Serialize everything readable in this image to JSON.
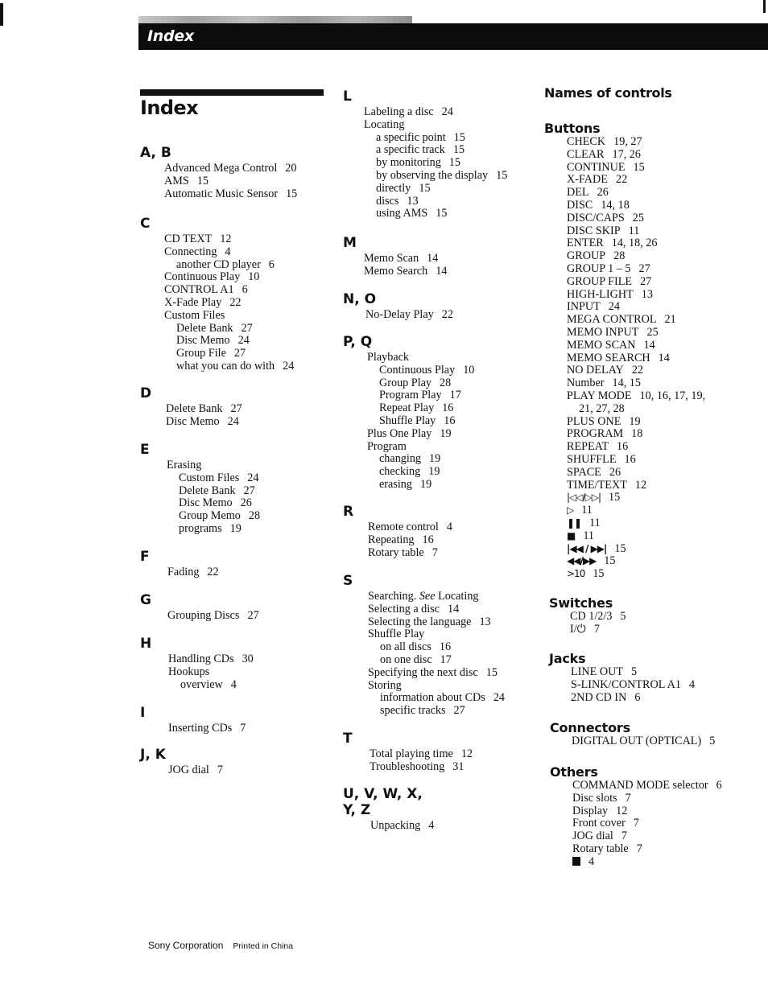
{
  "header": {
    "title": "Index"
  },
  "page_title": "Index",
  "left_sections": [
    {
      "letter": "A, B",
      "entries": [
        {
          "text": "Advanced Mega Control",
          "page": "20"
        },
        {
          "text": "AMS",
          "page": "15"
        },
        {
          "text": "Automatic Music Sensor",
          "page": "15"
        }
      ]
    },
    {
      "letter": "C",
      "entries": [
        {
          "text": "CD TEXT",
          "page": "12"
        },
        {
          "text": "Connecting",
          "page": "4"
        },
        {
          "text": "another CD player",
          "page": "6",
          "sub": true
        },
        {
          "text": "Continuous Play",
          "page": "10"
        },
        {
          "text": "CONTROL A1",
          "page": "6"
        },
        {
          "text": "X-Fade Play",
          "page": "22"
        },
        {
          "text": "Custom Files",
          "page": ""
        },
        {
          "text": "Delete Bank",
          "page": "27",
          "sub": true
        },
        {
          "text": "Disc Memo",
          "page": "24",
          "sub": true
        },
        {
          "text": "Group File",
          "page": "27",
          "sub": true
        },
        {
          "text": "what you can do with",
          "page": "24",
          "sub": true
        }
      ]
    },
    {
      "letter": "D",
      "entries": [
        {
          "text": "Delete Bank",
          "page": "27"
        },
        {
          "text": "Disc Memo",
          "page": "24"
        }
      ]
    },
    {
      "letter": "E",
      "entries": [
        {
          "text": "Erasing",
          "page": ""
        },
        {
          "text": "Custom Files",
          "page": "24",
          "sub": true
        },
        {
          "text": "Delete Bank",
          "page": "27",
          "sub": true
        },
        {
          "text": "Disc Memo",
          "page": "26",
          "sub": true
        },
        {
          "text": "Group Memo",
          "page": "28",
          "sub": true
        },
        {
          "text": "programs",
          "page": "19",
          "sub": true
        }
      ]
    },
    {
      "letter": "F",
      "entries": [
        {
          "text": "Fading",
          "page": "22"
        }
      ]
    },
    {
      "letter": "G",
      "entries": [
        {
          "text": "Grouping Discs",
          "page": "27"
        }
      ]
    },
    {
      "letter": "H",
      "entries": [
        {
          "text": "Handling CDs",
          "page": "30"
        },
        {
          "text": "Hookups",
          "page": ""
        },
        {
          "text": "overview",
          "page": "4",
          "sub": true
        }
      ]
    },
    {
      "letter": "I",
      "entries": [
        {
          "text": "Inserting CDs",
          "page": "7"
        }
      ]
    },
    {
      "letter": "J, K",
      "entries": [
        {
          "text": "JOG dial",
          "page": "7"
        }
      ]
    }
  ],
  "middle_sections": [
    {
      "letter": "L",
      "entries": [
        {
          "text": "Labeling a disc",
          "page": "24"
        },
        {
          "text": "Locating",
          "page": ""
        },
        {
          "text": "a specific point",
          "page": "15",
          "sub": true
        },
        {
          "text": "a specific track",
          "page": "15",
          "sub": true
        },
        {
          "text": "by monitoring",
          "page": "15",
          "sub": true
        },
        {
          "text": "by observing the display",
          "page": "15",
          "sub": true
        },
        {
          "text": "directly",
          "page": "15",
          "sub": true
        },
        {
          "text": "discs",
          "page": "13",
          "sub": true
        },
        {
          "text": "using AMS",
          "page": "15",
          "sub": true
        }
      ]
    },
    {
      "letter": "M",
      "entries": [
        {
          "text": "Memo Scan",
          "page": "14"
        },
        {
          "text": "Memo Search",
          "page": "14"
        }
      ]
    },
    {
      "letter": "N, O",
      "entries": [
        {
          "text": "No-Delay Play",
          "page": "22"
        }
      ]
    },
    {
      "letter": "P, Q",
      "entries": [
        {
          "text": "Playback",
          "page": ""
        },
        {
          "text": "Continuous Play",
          "page": "10",
          "sub": true
        },
        {
          "text": "Group Play",
          "page": "28",
          "sub": true
        },
        {
          "text": "Program Play",
          "page": "17",
          "sub": true
        },
        {
          "text": "Repeat Play",
          "page": "16",
          "sub": true
        },
        {
          "text": "Shuffle Play",
          "page": "16",
          "sub": true
        },
        {
          "text": "Plus One Play",
          "page": "19"
        },
        {
          "text": "Program",
          "page": ""
        },
        {
          "text": "changing",
          "page": "19",
          "sub": true
        },
        {
          "text": "checking",
          "page": "19",
          "sub": true
        },
        {
          "text": "erasing",
          "page": "19",
          "sub": true
        }
      ]
    },
    {
      "letter": "R",
      "entries": [
        {
          "text": "Remote control",
          "page": "4"
        },
        {
          "text": "Repeating",
          "page": "16"
        },
        {
          "text": "Rotary table",
          "page": "7"
        }
      ]
    },
    {
      "letter": "S",
      "entries": [
        {
          "text": "Searching.",
          "see": "See",
          "see_target": "Locating",
          "page": ""
        },
        {
          "text": "Selecting a disc",
          "page": "14"
        },
        {
          "text": "Selecting the language",
          "page": "13"
        },
        {
          "text": "Shuffle Play",
          "page": ""
        },
        {
          "text": "on all discs",
          "page": "16",
          "sub": true
        },
        {
          "text": "on one disc",
          "page": "17",
          "sub": true
        },
        {
          "text": "Specifying the next disc",
          "page": "15"
        },
        {
          "text": "Storing",
          "page": ""
        },
        {
          "text": "information about CDs",
          "page": "24",
          "sub": true
        },
        {
          "text": "specific tracks",
          "page": "27",
          "sub": true
        }
      ]
    },
    {
      "letter": "T",
      "entries": [
        {
          "text": "Total playing time",
          "page": "12"
        },
        {
          "text": "Troubleshooting",
          "page": "31"
        }
      ]
    },
    {
      "letter": "U, V, W, X, Y, Z",
      "entries": [
        {
          "text": "Unpacking",
          "page": "4"
        }
      ]
    }
  ],
  "names_of_controls": {
    "heading": "Names of controls",
    "buttons": {
      "heading": "Buttons",
      "entries": [
        {
          "text": "CHECK",
          "page": "19, 27"
        },
        {
          "text": "CLEAR",
          "page": "17, 26"
        },
        {
          "text": "CONTINUE",
          "page": "15"
        },
        {
          "text": "X-FADE",
          "page": "22"
        },
        {
          "text": "DEL",
          "page": "26"
        },
        {
          "text": "DISC",
          "page": "14, 18"
        },
        {
          "text": "DISC/CAPS",
          "page": "25"
        },
        {
          "text": "DISC SKIP",
          "page": "11"
        },
        {
          "text": "ENTER",
          "page": "14, 18, 26"
        },
        {
          "text": "GROUP",
          "page": "28"
        },
        {
          "text": "GROUP 1 – 5",
          "page": "27"
        },
        {
          "text": "GROUP FILE",
          "page": "27"
        },
        {
          "text": "HIGH-LIGHT",
          "page": "13"
        },
        {
          "text": "INPUT",
          "page": "24"
        },
        {
          "text": "MEGA CONTROL",
          "page": "21"
        },
        {
          "text": "MEMO INPUT",
          "page": "25"
        },
        {
          "text": "MEMO SCAN",
          "page": "14"
        },
        {
          "text": "MEMO SEARCH",
          "page": "14"
        },
        {
          "text": "NO DELAY",
          "page": "22"
        },
        {
          "text": "Number",
          "page": "14, 15"
        },
        {
          "text": "PLAY MODE",
          "page": "10, 16, 17, 19,"
        },
        {
          "text": "",
          "page": "21, 27, 28",
          "cont": true
        },
        {
          "text": "PLUS ONE",
          "page": "19"
        },
        {
          "text": "PROGRAM",
          "page": "18"
        },
        {
          "text": "REPEAT",
          "page": "16"
        },
        {
          "text": "SHUFFLE",
          "page": "16"
        },
        {
          "text": "SPACE",
          "page": "26"
        },
        {
          "text": "TIME/TEXT",
          "page": "12"
        }
      ],
      "symbol_entries": [
        {
          "icon": "skip-back-forward-outline-icon",
          "glyph": "|◁◁/▷▷|",
          "page": "15",
          "bold": false
        },
        {
          "icon": "play-outline-icon",
          "glyph": "▷",
          "page": "11",
          "bold": false
        },
        {
          "icon": "pause-icon",
          "glyph": "❚❚",
          "page": "11",
          "bold": true
        },
        {
          "icon": "stop-icon",
          "glyph": "■",
          "page": "11",
          "bold": true
        },
        {
          "icon": "skip-back-forward-icon",
          "glyph": "|◀◀ / ▶▶|",
          "page": "15",
          "bold": true
        },
        {
          "icon": "rewind-fastforward-icon",
          "glyph": "◀◀/▶▶",
          "page": "15",
          "bold": true
        },
        {
          "icon": "greater-than-ten-icon",
          "glyph": ">10",
          "page": "15",
          "bold": false
        }
      ]
    },
    "switches": {
      "heading": "Switches",
      "entries": [
        {
          "text": "CD 1/2/3",
          "page": "5"
        },
        {
          "text": "I/⏻",
          "page": "7"
        }
      ]
    },
    "jacks": {
      "heading": "Jacks",
      "entries": [
        {
          "text": "LINE OUT",
          "page": "5"
        },
        {
          "text": "S-LINK/CONTROL A1",
          "page": "4"
        },
        {
          "text": "2ND CD IN",
          "page": "6"
        }
      ]
    },
    "connectors": {
      "heading": "Connectors",
      "entries": [
        {
          "text": "DIGITAL OUT (OPTICAL)",
          "page": "5"
        }
      ]
    },
    "others": {
      "heading": "Others",
      "entries": [
        {
          "text": "COMMAND MODE selector",
          "page": "6"
        },
        {
          "text": "Disc slots",
          "page": "7"
        },
        {
          "text": "Display",
          "page": "12"
        },
        {
          "text": "Front cover",
          "page": "7"
        },
        {
          "text": "JOG dial",
          "page": "7"
        },
        {
          "text": "Rotary table",
          "page": "7"
        }
      ],
      "symbol_entry": {
        "icon": "remote-sensor-icon",
        "page": "4"
      }
    }
  },
  "footer": {
    "company": "Sony Corporation",
    "printed": "Printed in China"
  }
}
